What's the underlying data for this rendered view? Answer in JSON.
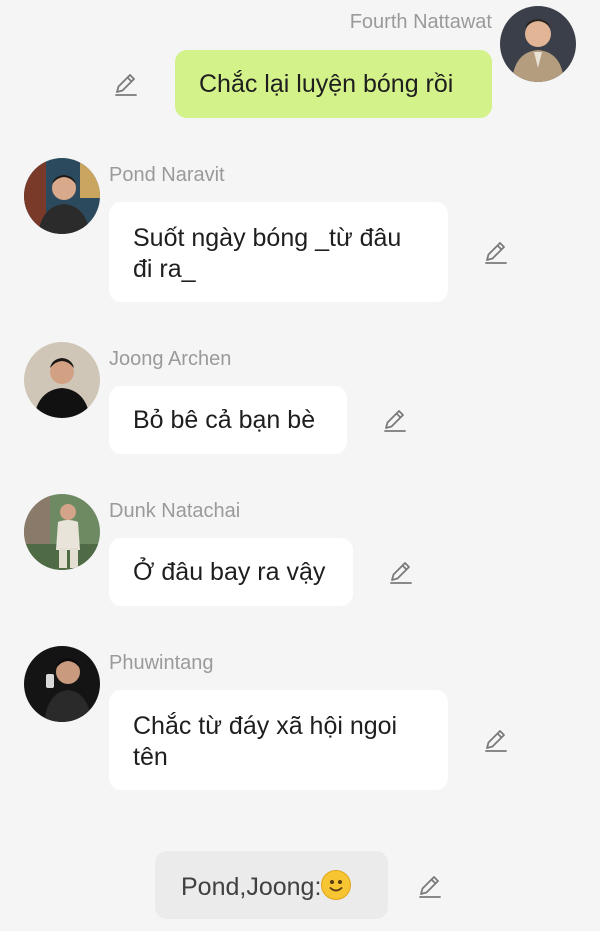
{
  "messages": [
    {
      "author": "Fourth Nattawat",
      "text": "Chắc lại luyện bóng rồi",
      "avatar": "portrait photo, man in beige suit"
    },
    {
      "author": "Pond Naravit",
      "text": "Suốt ngày bóng _từ đâu đi ra_",
      "avatar": "portrait photo, man in dark shirt"
    },
    {
      "author": "Joong Archen",
      "text": "Bỏ bê cả bạn bè",
      "avatar": "portrait photo, man in black"
    },
    {
      "author": "Dunk Natachai",
      "text": "Ở đâu bay ra vậy",
      "avatar": "full-body photo, man in light outfit"
    },
    {
      "author": "Phuwintang",
      "text": "Chắc từ đáy xã hội ngoi tên",
      "avatar": "mirror selfie photo"
    }
  ],
  "note": {
    "text": "Pond,Joong:",
    "emoji": "slightly-smiling-face"
  },
  "icons": {
    "edit": "pencil-edit-icon"
  },
  "colors": {
    "background": "#f5f5f5",
    "own_bubble": "#d4f28a",
    "other_bubble": "#ffffff",
    "note_bubble": "#ebebeb",
    "name": "#9a9a9a"
  }
}
